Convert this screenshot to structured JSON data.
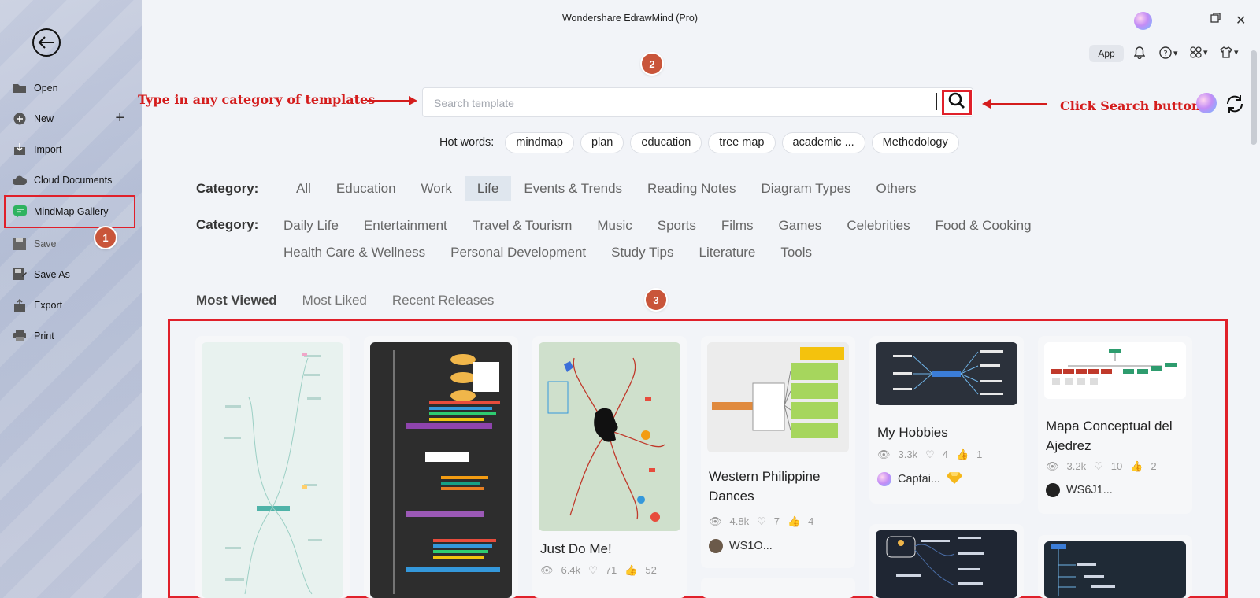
{
  "window": {
    "title": "Wondershare EdrawMind (Pro)"
  },
  "sidebar": {
    "items": [
      {
        "label": "Open",
        "icon": "folder-icon"
      },
      {
        "label": "New",
        "icon": "plus-circle-icon"
      },
      {
        "label": "Import",
        "icon": "import-icon"
      },
      {
        "label": "Cloud Documents",
        "icon": "cloud-icon"
      },
      {
        "label": "MindMap Gallery",
        "icon": "gallery-icon"
      },
      {
        "label": "Save",
        "icon": "save-icon"
      },
      {
        "label": "Save As",
        "icon": "save-as-icon"
      },
      {
        "label": "Export",
        "icon": "export-icon"
      },
      {
        "label": "Print",
        "icon": "print-icon"
      }
    ]
  },
  "toolbar": {
    "app_label": "App"
  },
  "search": {
    "placeholder": "Search template",
    "value": "",
    "hot_words_label": "Hot words:",
    "hot_words": [
      "mindmap",
      "plan",
      "education",
      "tree map",
      "academic ...",
      "Methodology"
    ]
  },
  "annotations": {
    "type_hint": "Type in any category of templates",
    "click_hint": "Click Search button",
    "steps": [
      "1",
      "2",
      "3"
    ]
  },
  "categories": {
    "label": "Category:",
    "main": [
      "All",
      "Education",
      "Work",
      "Life",
      "Events & Trends",
      "Reading Notes",
      "Diagram Types",
      "Others"
    ],
    "active": "Life",
    "sub_label": "Category:",
    "sub": [
      "Daily Life",
      "Entertainment",
      "Travel & Tourism",
      "Music",
      "Sports",
      "Films",
      "Games",
      "Celebrities",
      "Food & Cooking",
      "Health Care & Wellness",
      "Personal Development",
      "Study Tips",
      "Literature",
      "Tools"
    ]
  },
  "sort_tabs": [
    "Most Viewed",
    "Most Liked",
    "Recent Releases"
  ],
  "cards": [
    {
      "title": "",
      "views": "",
      "likes": "",
      "forks": "",
      "author": ""
    },
    {
      "title": "",
      "views": "",
      "likes": "",
      "forks": "",
      "author": ""
    },
    {
      "title": "Just Do Me!",
      "views": "6.4k",
      "likes": "71",
      "forks": "52",
      "author": ""
    },
    {
      "title": "Western Philippine Dances",
      "views": "4.8k",
      "likes": "7",
      "forks": "4",
      "author": "WS1O..."
    },
    {
      "title": "My Hobbies",
      "views": "3.3k",
      "likes": "4",
      "forks": "1",
      "author": "Captai..."
    },
    {
      "title": "Mapa Conceptual del Ajedrez",
      "views": "3.2k",
      "likes": "10",
      "forks": "2",
      "author": "WS6J1..."
    }
  ],
  "colors": {
    "accent_red": "#e0202a",
    "badge": "#c9553a",
    "active_category_bg": "#dfe6ee"
  }
}
